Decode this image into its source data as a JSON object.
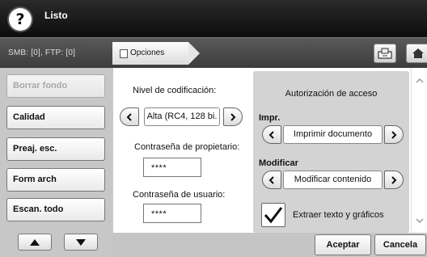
{
  "header": {
    "help_icon_glyph": "?",
    "status": "Listo"
  },
  "pathbar": {
    "connection_info": "SMB: [0], FTP: [0]",
    "breadcrumb": "Opciones"
  },
  "sidebar": {
    "items": [
      {
        "label": "Borrar fondo",
        "enabled": false
      },
      {
        "label": "Calidad",
        "enabled": true
      },
      {
        "label": "Preaj. esc.",
        "enabled": true
      },
      {
        "label": "Form arch",
        "enabled": true
      },
      {
        "label": "Escan. todo",
        "enabled": true
      }
    ]
  },
  "encryption": {
    "label": "Nivel de codificación:",
    "value": "Alta (RC4, 128 bi.",
    "owner_password_label": "Contraseña de propietario:",
    "owner_password_value": "****",
    "user_password_label": "Contraseña de usuario:",
    "user_password_value": "****"
  },
  "access": {
    "title": "Autorización de acceso",
    "print_label": "Impr.",
    "print_value": "Imprimir documento",
    "modify_label": "Modificar",
    "modify_value": "Modificar contenido",
    "extract_label": "Extraer texto y gráficos",
    "extract_checked": true
  },
  "footer": {
    "ok_label": "Aceptar",
    "cancel_label": "Cancela"
  },
  "colors": {
    "header_bg": "#141414",
    "pathbar_bg": "#4a4a4a",
    "sidebar_bg": "#c7c7c7",
    "access_panel_bg": "#d3d3d3"
  }
}
